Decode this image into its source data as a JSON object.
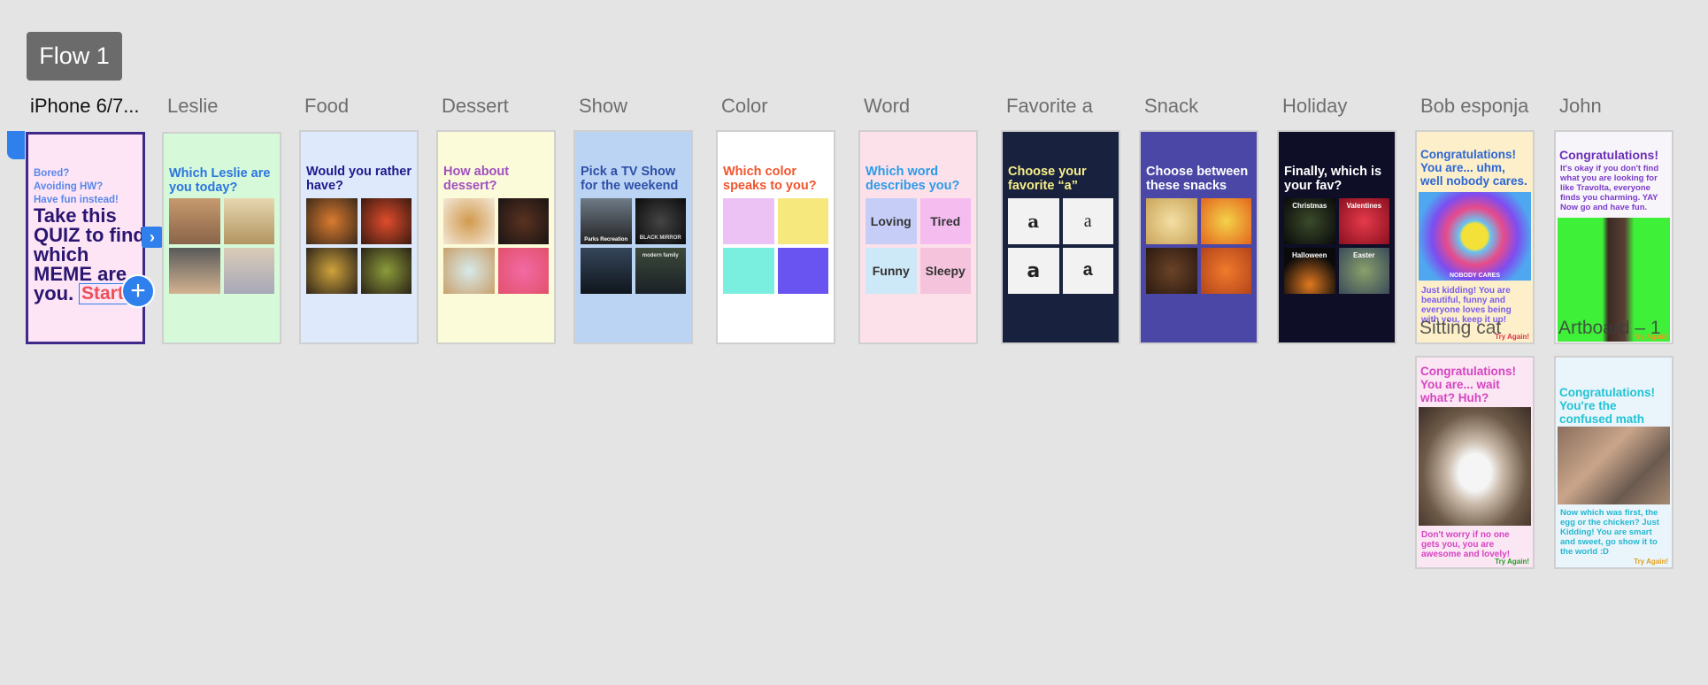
{
  "flow_badge": "Flow 1",
  "labels": {
    "iphone": "iPhone 6/7...",
    "leslie": "Leslie",
    "food": "Food",
    "dessert": "Dessert",
    "show": "Show",
    "color": "Color",
    "word": "Word",
    "favorite": "Favorite a",
    "snack": "Snack",
    "holiday": "Holiday",
    "bob": "Bob esponja",
    "john": "John"
  },
  "iphone": {
    "lines": [
      "Bored?",
      "Avoiding HW?",
      "Have fun instead!"
    ],
    "headline": "Take this QUIZ to find which MEME are you.",
    "start": "Start"
  },
  "leslie": {
    "question": "Which Leslie are you today?"
  },
  "food": {
    "question": "Would you rather have?"
  },
  "dessert": {
    "question": "How about dessert?"
  },
  "show": {
    "question": "Pick a TV Show for the weekend",
    "tile1": "Parks Recreation",
    "tile2": "BLACK MIRROR",
    "tile4": "modern family"
  },
  "color": {
    "question": "Which color speaks to you?"
  },
  "word": {
    "question": "Which word describes you?",
    "options": [
      "Loving",
      "Tired",
      "Funny",
      "Sleepy"
    ]
  },
  "favorite": {
    "question": "Choose your favorite “a”",
    "options": [
      "a",
      "a",
      "a",
      "a"
    ]
  },
  "snack": {
    "question": "Choose between these snacks"
  },
  "holiday": {
    "question": "Finally, which is your fav?",
    "options": [
      "Christmas",
      "Valentines",
      "Halloween",
      "Easter"
    ]
  },
  "bob": {
    "title": "Congratulations! You are... uhm, well nobody cares.",
    "image_caption": "NOBODY CARES",
    "body": "Just kidding! You are beautiful, funny and everyone loves being with you, keep it up!",
    "try_again": "Try Again!",
    "overlay": "Sitting cat"
  },
  "john": {
    "title": "Congratulations!",
    "body": "It's okay if you don't find what you are looking for like Travolta, everyone finds you charming. YAY Now go and have fun.",
    "try_again": "Try Again!",
    "overlay": "Artboard – 1"
  },
  "cat": {
    "title": "Congratulations! You are... wait what? Huh?",
    "body": "Don't worry if no one gets you, you are awesome and lovely!",
    "try_again": "Try Again!"
  },
  "math": {
    "title": "Congratulations! You're the confused math lady!",
    "body": "Now which was first, the egg or the chicken? Just Kidding! You are smart and sweet, go show it to the world :D",
    "try_again": "Try Again!"
  },
  "colors": {
    "selection": "#2f80ed",
    "selected_border": "#3f2a8a"
  }
}
